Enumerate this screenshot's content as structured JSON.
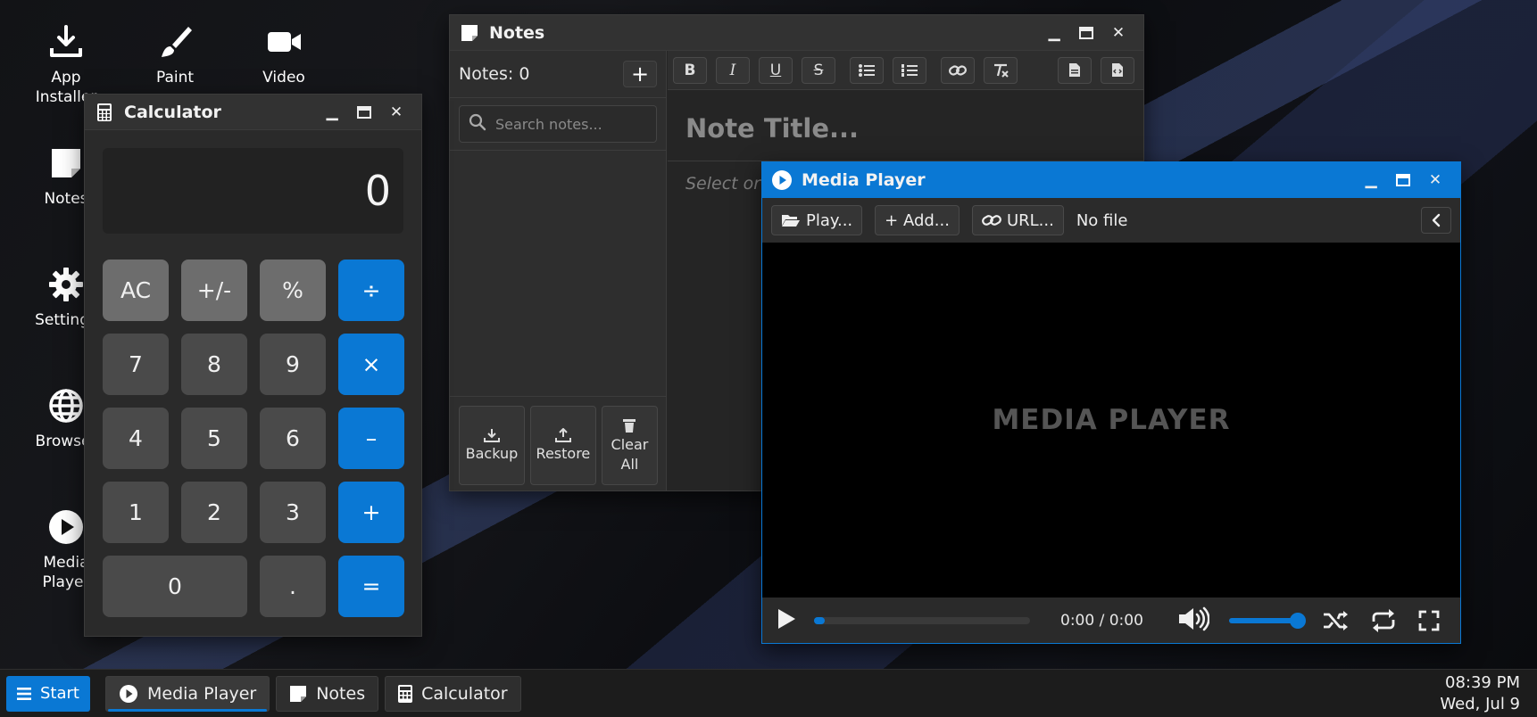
{
  "desktop": {
    "icons": [
      {
        "label": "App Installer",
        "icon": "download-icon"
      },
      {
        "label": "Paint",
        "icon": "paintbrush-icon"
      },
      {
        "label": "Video",
        "icon": "video-camera-icon"
      },
      {
        "label": "Notes",
        "icon": "note-icon"
      },
      {
        "label": "Settings",
        "icon": "gear-icon"
      },
      {
        "label": "Browser",
        "icon": "globe-icon"
      },
      {
        "label": "Media Player",
        "icon": "play-circle-icon"
      }
    ]
  },
  "calculator": {
    "title": "Calculator",
    "display": "0",
    "keys": [
      "AC",
      "+/-",
      "%",
      "÷",
      "7",
      "8",
      "9",
      "×",
      "4",
      "5",
      "6",
      "–",
      "1",
      "2",
      "3",
      "+",
      "0",
      ".",
      "="
    ]
  },
  "notes": {
    "title": "Notes",
    "count_label": "Notes: 0",
    "add_label": "+",
    "search_placeholder": "Search notes...",
    "footer": {
      "backup": "Backup",
      "restore": "Restore",
      "clear": "Clear All"
    },
    "toolbar": {
      "bold": "B",
      "italic": "I",
      "underline": "U",
      "strike": "S"
    },
    "title_placeholder": "Note Title...",
    "body_placeholder": "Select or"
  },
  "media_player": {
    "title": "Media Player",
    "play_label": "Play...",
    "add_label": "+ Add...",
    "url_label": "URL...",
    "file_status": "No file",
    "stage_text": "MEDIA PLAYER",
    "time": "0:00 / 0:00",
    "seek_fraction": 0.05,
    "volume_fraction": 0.9
  },
  "taskbar": {
    "start": "Start",
    "tasks": [
      "Media Player",
      "Notes",
      "Calculator"
    ],
    "time": "08:39 PM",
    "date": "Wed, Jul 9"
  },
  "colors": {
    "accent": "#0a78d4"
  }
}
